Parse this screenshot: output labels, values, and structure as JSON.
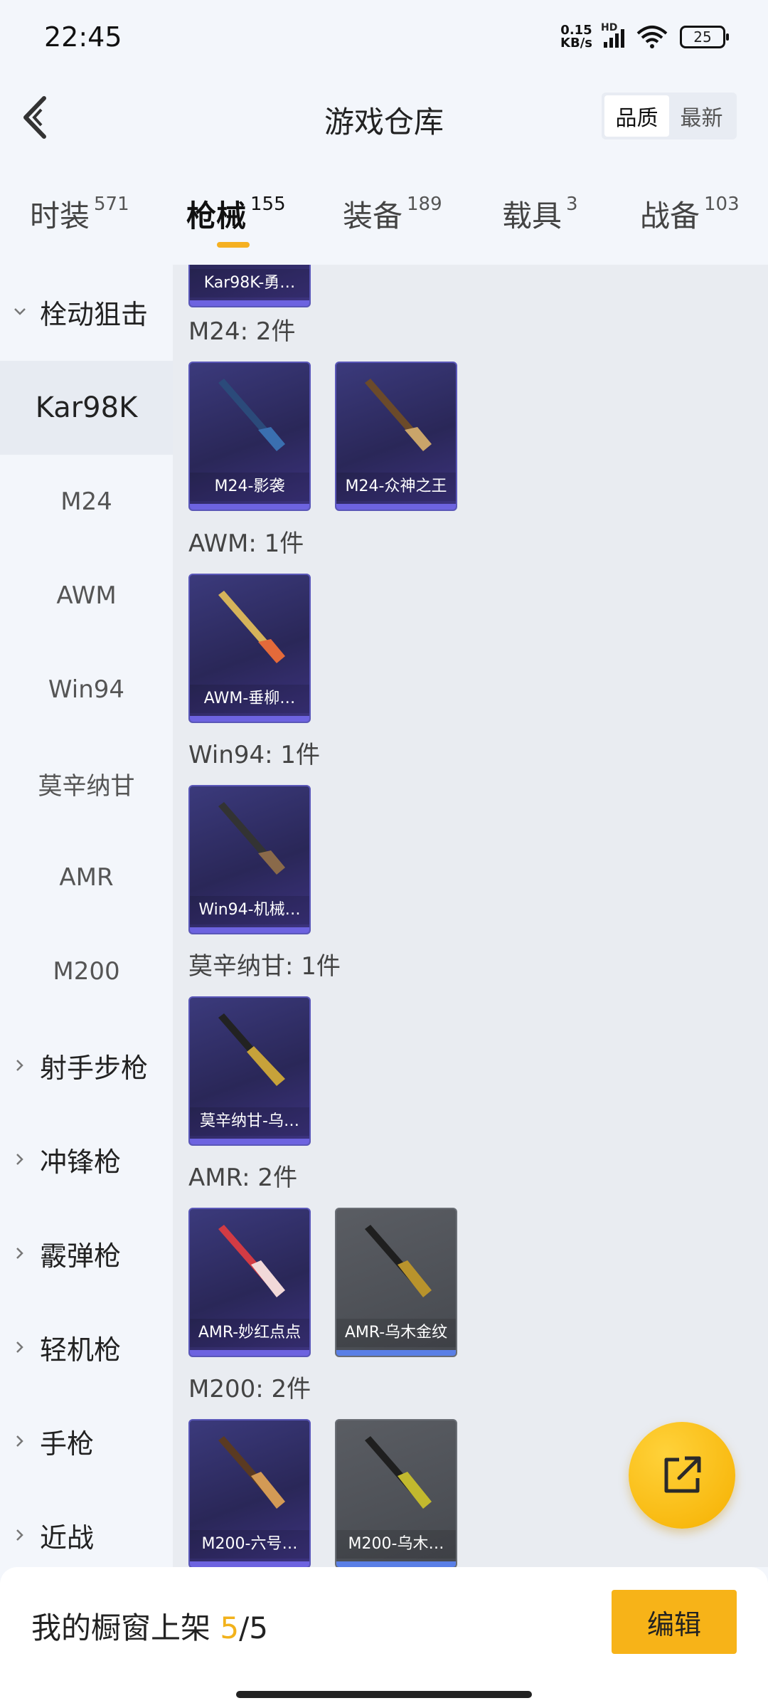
{
  "status_bar": {
    "time": "22:45",
    "net_speed_value": "0.15",
    "net_speed_unit": "KB/s",
    "hd": "HD",
    "battery": "25"
  },
  "header": {
    "title": "游戏仓库",
    "sort_options": [
      "品质",
      "最新"
    ],
    "active_sort": "品质"
  },
  "tabs": [
    {
      "label": "时装",
      "count": "571"
    },
    {
      "label": "枪械",
      "count": "155"
    },
    {
      "label": "装备",
      "count": "189"
    },
    {
      "label": "载具",
      "count": "3"
    },
    {
      "label": "战备",
      "count": "103"
    }
  ],
  "sidebar": {
    "groups": [
      {
        "label": "栓动狙击",
        "expanded": true
      },
      {
        "label": "射手步枪"
      },
      {
        "label": "冲锋枪"
      },
      {
        "label": "霰弹枪"
      },
      {
        "label": "轻机枪"
      },
      {
        "label": "手枪"
      },
      {
        "label": "近战"
      }
    ],
    "subs": [
      "Kar98K",
      "M24",
      "AWM",
      "Win94",
      "莫辛纳甘",
      "AMR",
      "M200"
    ],
    "active_sub": "Kar98K"
  },
  "content": {
    "partial_card": "Kar98K-勇…",
    "groups": [
      {
        "title": "M24: 2件",
        "items": [
          {
            "name": "M24-影袭",
            "style": "purple"
          },
          {
            "name": "M24-众神之王",
            "style": "purple"
          }
        ]
      },
      {
        "title": "AWM: 1件",
        "items": [
          {
            "name": "AWM-垂柳…",
            "style": "purple"
          }
        ]
      },
      {
        "title": "Win94: 1件",
        "items": [
          {
            "name": "Win94-机械…",
            "style": "purple"
          }
        ]
      },
      {
        "title": "莫辛纳甘: 1件",
        "items": [
          {
            "name": "莫辛纳甘-乌…",
            "style": "purple"
          }
        ]
      },
      {
        "title": "AMR: 2件",
        "items": [
          {
            "name": "AMR-妙红点点",
            "style": "purple"
          },
          {
            "name": "AMR-乌木金纹",
            "style": "gray"
          }
        ]
      },
      {
        "title": "M200: 2件",
        "items": [
          {
            "name": "M200-六号…",
            "style": "purple"
          },
          {
            "name": "M200-乌木…",
            "style": "gray"
          }
        ]
      }
    ]
  },
  "bottom": {
    "shelf_label": "我的橱窗上架",
    "shelf_current": "5",
    "shelf_sep": "/",
    "shelf_total": "5",
    "edit_label": "编辑"
  },
  "colors": {
    "accent": "#f5b021",
    "card_purple": "#2f2c66",
    "card_gray": "#4f5258"
  },
  "icons": {
    "back": "back-chevron-icon",
    "fab": "share-icon"
  }
}
